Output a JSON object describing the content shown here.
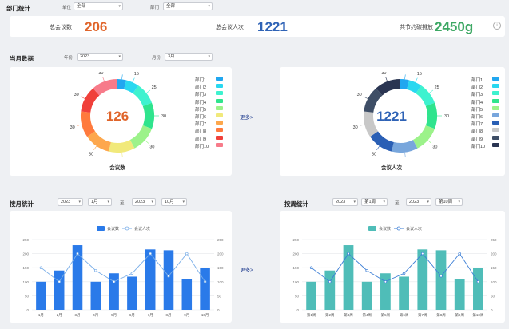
{
  "dept_stats": {
    "title": "部门统计",
    "unit_label": "单位",
    "unit_value": "全部",
    "dept_label": "部门",
    "dept_value": "全部"
  },
  "summary": {
    "total_meetings_label": "总会议数",
    "total_meetings_value": "206",
    "total_attendance_label": "总会议人次",
    "total_attendance_value": "1221",
    "paper_saved_label": "共节约碳排放",
    "paper_saved_value": "2450g",
    "info_icon": "info-icon"
  },
  "month_data": {
    "title": "当月数据",
    "year_label": "年份",
    "year_value": "2023",
    "month_label": "月份",
    "month_value": "3月",
    "more_label": "更多>"
  },
  "donut_meetings": {
    "center_value": "126",
    "caption": "会议数",
    "center_color": "#e0652b",
    "slice_labels": [
      "10",
      "15",
      "25",
      "30",
      "30",
      "30",
      "30",
      "30",
      "30",
      "30"
    ],
    "legend": [
      "部门1",
      "部门2",
      "部门3",
      "部门4",
      "部门5",
      "部门6",
      "部门7",
      "部门8",
      "部门9",
      "部门10"
    ],
    "colors": [
      "#21a7f0",
      "#29d8f0",
      "#3ef2cf",
      "#2fe48d",
      "#9cf28a",
      "#f1e97b",
      "#fda74c",
      "#ff7a3d",
      "#f0403a",
      "#f77b8a"
    ]
  },
  "donut_attendance": {
    "center_value": "1221",
    "caption": "会议人次",
    "center_color": "#2f63b6",
    "slice_labels": [
      "10",
      "15",
      "25",
      "30",
      "30",
      "30",
      "30",
      "30",
      "30",
      "30"
    ],
    "legend": [
      "部门1",
      "部门2",
      "部门3",
      "部门4",
      "部门5",
      "部门6",
      "部门7",
      "部门8",
      "部门9",
      "部门10"
    ],
    "colors": [
      "#21a7f0",
      "#29d8f0",
      "#3ef2cf",
      "#2fe48d",
      "#9cf28a",
      "#78a6dc",
      "#2a5fb5",
      "#c8c8c8",
      "#3e4e66",
      "#2a3552"
    ]
  },
  "monthly": {
    "title": "按月统计",
    "from_year": "2023",
    "from_month": "1月",
    "to_label": "至",
    "to_year": "2023",
    "to_month": "10月",
    "more_label": "更多>",
    "legend_bar": "会议数",
    "legend_line": "会议人次"
  },
  "weekly": {
    "title": "按周统计",
    "from_year": "2023",
    "from_week": "第1周",
    "to_label": "至",
    "to_year": "2023",
    "to_week": "第10周",
    "legend_bar": "会议数",
    "legend_line": "会议人次"
  },
  "chart_data": [
    {
      "type": "bar",
      "categories": [
        "1月",
        "2月",
        "3月",
        "4月",
        "5月",
        "6月",
        "7月",
        "8月",
        "9月",
        "10月"
      ],
      "series": [
        {
          "name": "会议数",
          "type": "bar",
          "values": [
            100,
            140,
            230,
            100,
            130,
            118,
            215,
            212,
            108,
            148
          ]
        },
        {
          "name": "会议人次",
          "type": "line",
          "values": [
            150,
            100,
            200,
            140,
            100,
            130,
            200,
            120,
            200,
            100
          ]
        }
      ],
      "ylim": [
        0,
        250
      ],
      "yticks": [
        "0",
        "50",
        "100",
        "150",
        "200",
        "250"
      ],
      "bar_color": "#2a7ae9",
      "line_color": "#7aaee8"
    },
    {
      "type": "bar",
      "categories": [
        "第1周",
        "第2周",
        "第3周",
        "第4周",
        "第5周",
        "第6周",
        "第7周",
        "第8周",
        "第9周",
        "第10周"
      ],
      "series": [
        {
          "name": "会议数",
          "type": "bar",
          "values": [
            100,
            140,
            230,
            100,
            130,
            118,
            215,
            212,
            108,
            148
          ]
        },
        {
          "name": "会议人次",
          "type": "line",
          "values": [
            150,
            100,
            200,
            140,
            100,
            130,
            200,
            120,
            200,
            100
          ]
        }
      ],
      "ylim": [
        0,
        250
      ],
      "yticks": [
        "0",
        "50",
        "100",
        "150",
        "200",
        "250"
      ],
      "bar_color": "#4fbdb8",
      "line_color": "#3d7fd6"
    }
  ]
}
